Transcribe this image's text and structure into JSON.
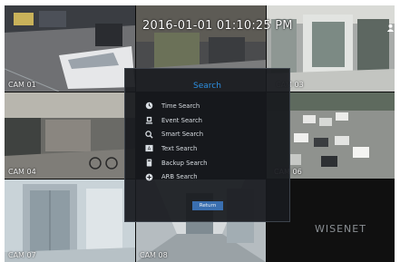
{
  "overlay": {
    "timestamp": "2016-01-01 01:10:25 PM",
    "brand": "WISENET"
  },
  "cameras": [
    {
      "label": "CAM 01"
    },
    {
      "label": ""
    },
    {
      "label": "CAM 03"
    },
    {
      "label": "CAM 04"
    },
    {
      "label": "CAM 06"
    },
    {
      "label": "CAM 07"
    },
    {
      "label": "CAM 08"
    }
  ],
  "dialog": {
    "title": "Search",
    "items": [
      {
        "label": "Time Search",
        "icon": "clock-icon"
      },
      {
        "label": "Event Search",
        "icon": "event-icon"
      },
      {
        "label": "Smart Search",
        "icon": "smart-search-icon"
      },
      {
        "label": "Text Search",
        "icon": "text-search-icon"
      },
      {
        "label": "Backup Search",
        "icon": "backup-icon"
      },
      {
        "label": "ARB Search",
        "icon": "arb-icon"
      }
    ],
    "return_label": "Return"
  },
  "colors": {
    "accent": "#2d8fe0",
    "button": "#3a6fb0",
    "dialog_bg": "#181a1e"
  }
}
